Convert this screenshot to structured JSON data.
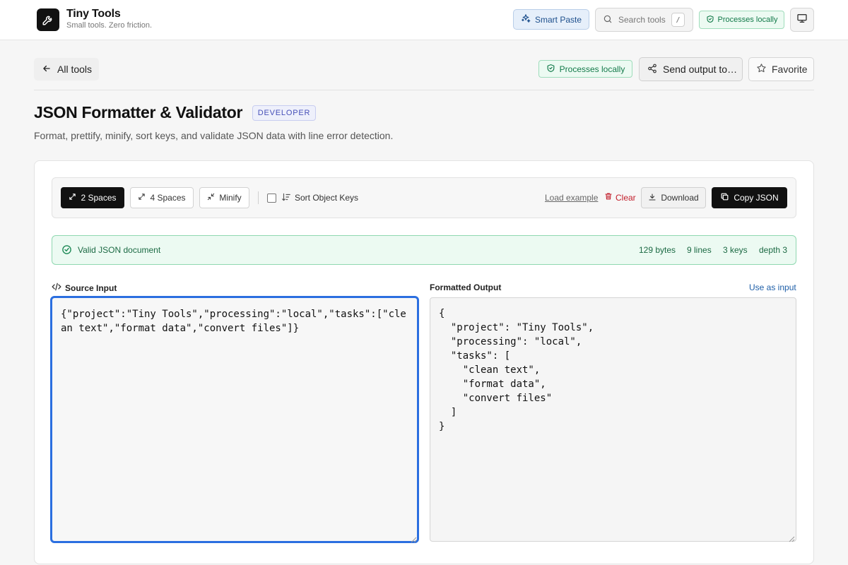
{
  "header": {
    "brand_title": "Tiny Tools",
    "brand_subtitle": "Small tools. Zero friction.",
    "smart_paste_label": "Smart Paste",
    "search_placeholder": "Search tools",
    "search_shortcut": "/",
    "processes_locally_label": "Processes locally"
  },
  "subheader": {
    "back_label": "All tools",
    "processes_locally_label": "Processes locally",
    "send_output_label": "Send output to…",
    "favorite_label": "Favorite"
  },
  "page": {
    "title": "JSON Formatter & Validator",
    "category_badge": "DEVELOPER",
    "description": "Format, prettify, minify, sort keys, and validate JSON data with line error detection."
  },
  "toolbar": {
    "indent_2_label": "2 Spaces",
    "indent_4_label": "4 Spaces",
    "minify_label": "Minify",
    "sort_keys_label": "Sort Object Keys",
    "sort_keys_checked": false,
    "active_mode": "2 Spaces",
    "load_example_label": "Load example",
    "clear_label": "Clear",
    "download_label": "Download",
    "copy_label": "Copy JSON"
  },
  "status": {
    "message": "Valid JSON document",
    "bytes": "129 bytes",
    "lines": "9 lines",
    "keys": "3 keys",
    "depth": "depth 3"
  },
  "editor": {
    "source_label": "Source Input",
    "output_label": "Formatted Output",
    "use_as_input_label": "Use as input",
    "source_value": "{\"project\":\"Tiny Tools\",\"processing\":\"local\",\"tasks\":[\"clean text\",\"format data\",\"convert files\"]}",
    "output_value": "{\n  \"project\": \"Tiny Tools\",\n  \"processing\": \"local\",\n  \"tasks\": [\n    \"clean text\",\n    \"format data\",\n    \"convert files\"\n  ]\n}"
  },
  "colors": {
    "accent_focus": "#2b6fe0",
    "success_green": "#137a4a",
    "danger_red": "#c21d2a",
    "badge_indigo": "#4750b8",
    "primary_dark": "#111111"
  },
  "icons": {
    "logo": "wrench-icon",
    "smart_paste": "sparkles-icon",
    "search": "search-icon",
    "shield": "shield-check-icon",
    "monitor": "monitor-icon",
    "back": "arrow-left-icon",
    "share": "share-icon",
    "favorite": "star-icon",
    "expand": "expand-icon",
    "minify": "shrink-icon",
    "sort": "sort-icon",
    "trash": "trash-icon",
    "download": "download-icon",
    "copy": "copy-icon",
    "valid": "check-circle-icon",
    "code": "code-icon"
  }
}
